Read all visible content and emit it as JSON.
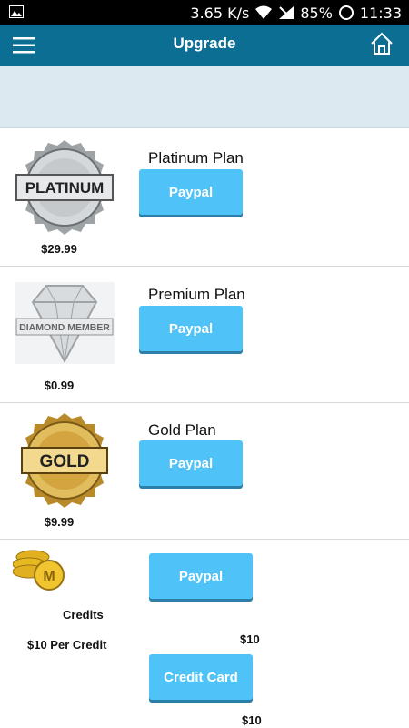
{
  "status": {
    "speed": "3.65 K/s",
    "battery": "85%",
    "time": "11:33"
  },
  "app": {
    "title": "Upgrade"
  },
  "plans": [
    {
      "name": "Platinum Plan",
      "price": "$29.99",
      "button": "Paypal",
      "badge_text": "PLATINUM"
    },
    {
      "name": "Premium Plan",
      "price": "$0.99",
      "button": "Paypal",
      "badge_text": "DIAMOND MEMBER"
    },
    {
      "name": "Gold Plan",
      "price": "$9.99",
      "button": "Paypal",
      "badge_text": "GOLD"
    }
  ],
  "credits": {
    "label": "Credits",
    "rate": "$10 Per Credit",
    "paypal_button": "Paypal",
    "paypal_price": "$10",
    "card_button": "Credit Card",
    "card_price": "$10"
  }
}
